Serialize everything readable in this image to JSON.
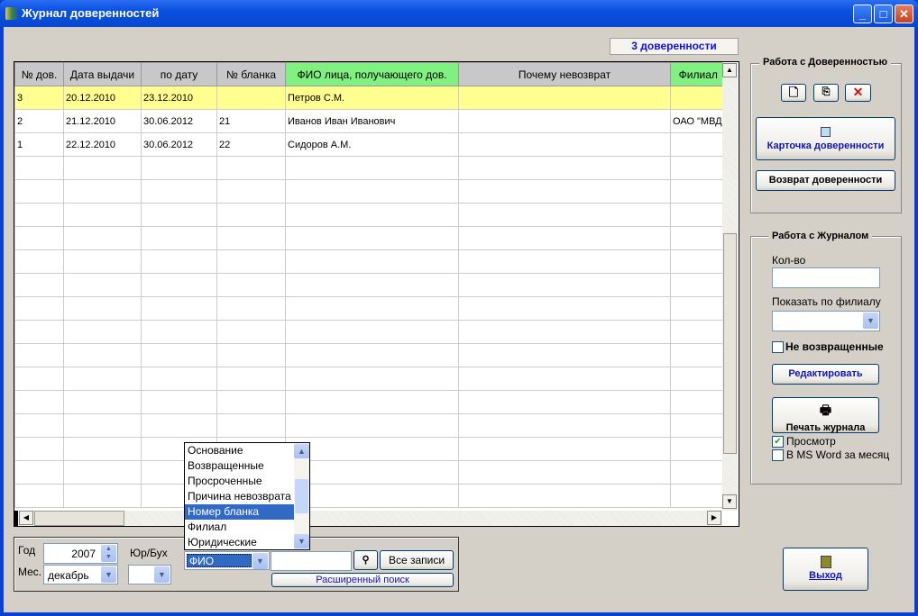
{
  "window": {
    "title": "Журнал доверенностей",
    "minimize": "_",
    "maximize": "□",
    "close": "✕"
  },
  "badge": "3 доверенности",
  "grid": {
    "columns": [
      "№ дов.",
      "Дата выдачи",
      "по дату",
      "№ бланка",
      "ФИО лица, получающего дов.",
      "Почему невозврат",
      "Филиал"
    ],
    "rows": [
      [
        "3",
        "20.12.2010",
        "23.12.2010",
        "",
        "Петров С.М.",
        "",
        ""
      ],
      [
        "2",
        "21.12.2010",
        "30.06.2012",
        "21",
        "Иванов Иван Иванович",
        "",
        "ОАО \"МВД\""
      ],
      [
        "1",
        "22.12.2010",
        "30.06.2012",
        "22",
        "Сидоров А.М.",
        "",
        ""
      ]
    ],
    "selected_row": 0,
    "highlight_color": "#ffff90",
    "header_accent": "#80f080"
  },
  "doc_group": {
    "title": "Работа с Доверенностью",
    "new_icon": "new-document-icon",
    "copy_icon": "copy-icon",
    "delete_icon": "delete-icon",
    "card_button": "Карточка доверенности",
    "return_button": "Возврат доверенности"
  },
  "journal_group": {
    "title": "Работа с Журналом",
    "qty_label": "Кол-во",
    "qty_value": "",
    "branch_label": "Показать по филиалу",
    "branch_value": "",
    "not_returned_label": "Не возвращенные",
    "not_returned": false,
    "edit_button": "Редактировать",
    "print_button": "Печать журнала",
    "preview_label": "Просмотр",
    "preview": true,
    "word_label": "В MS Word за месяц",
    "word": false
  },
  "exit_button": "Выход",
  "filter": {
    "year_label": "Год",
    "year": "2007",
    "month_label": "Мес.",
    "month": "декабрь",
    "type_label": "Юр/Бух",
    "type_value": "",
    "field": "ФИО",
    "search_value": "",
    "all_button": "Все записи",
    "advanced_button": "Расширенный поиск",
    "options": [
      "Основание",
      "Возвращенные",
      "Просроченные",
      "Причина невозврата",
      "Номер бланка",
      "Филиал",
      "Юридические"
    ],
    "highlighted_option": 4
  }
}
